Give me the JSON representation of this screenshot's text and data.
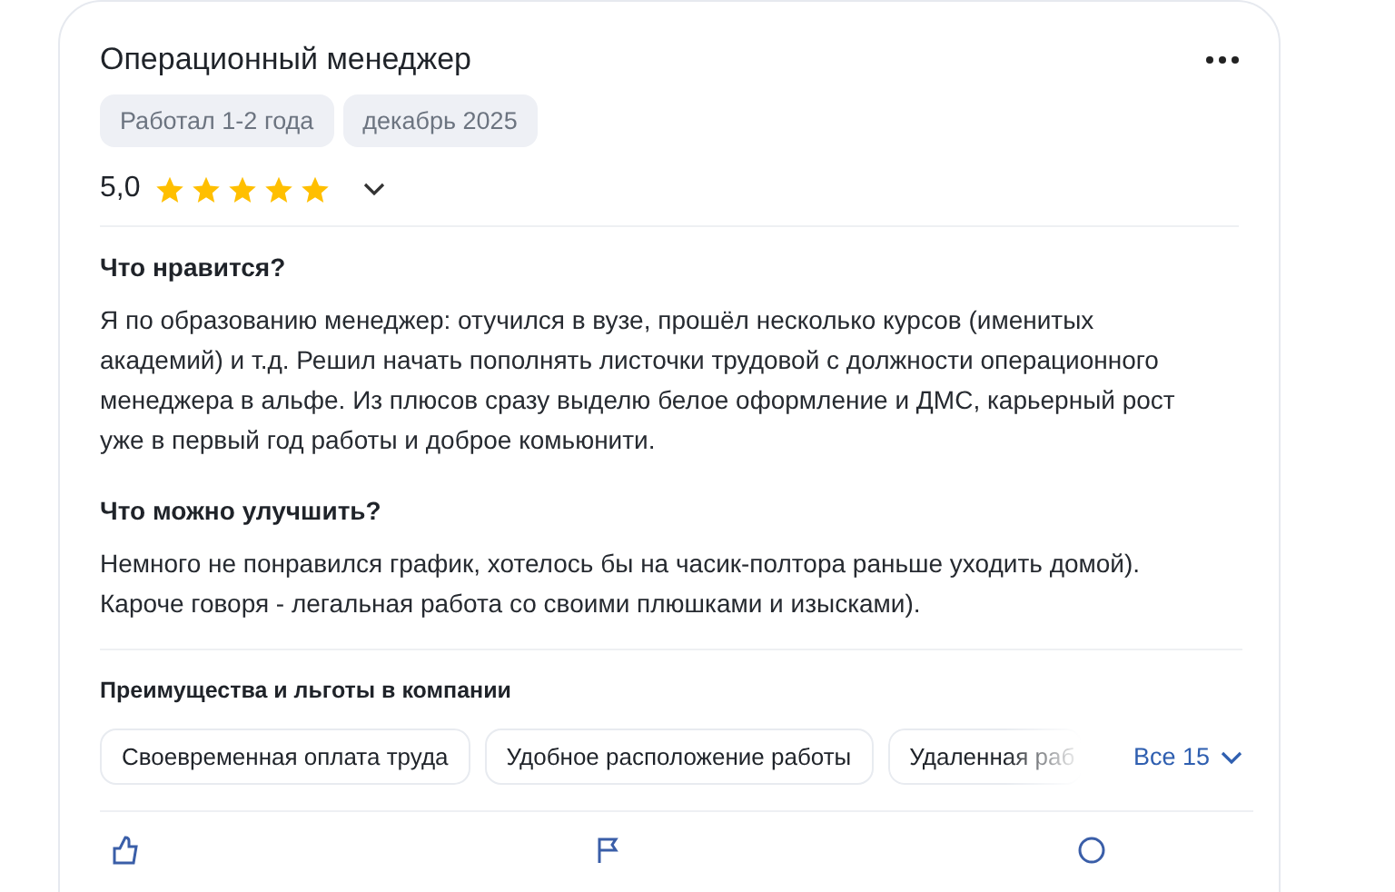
{
  "review": {
    "title": "Операционный менеджер",
    "tags": [
      "Работал 1-2 года",
      "декабрь 2025"
    ],
    "rating": "5,0",
    "stars": 5,
    "sections": [
      {
        "heading": "Что нравится?",
        "text": "Я по образованию менеджер: отучился в вузе, прошёл несколько курсов (именитых академий) и т.д. Решил начать пополнять листочки трудовой с должности операционного менеджера в альфе. Из плюсов сразу выделю белое оформление и ДМС, карьерный рост уже в первый год работы и доброе комьюнити."
      },
      {
        "heading": "Что можно улучшить?",
        "text": "Немного не понравился график, хотелось бы на часик-полтора раньше уходить домой). Кароче говоря - легальная работа со своими плюшками и изысками)."
      }
    ],
    "benefits": {
      "heading": "Преимущества и льготы в компании",
      "chips": [
        {
          "label": "Своевременная оплата труда",
          "faded": false
        },
        {
          "label": "Удобное расположение работы",
          "faded": false
        },
        {
          "label": "Удаленная раб",
          "faded": true
        }
      ],
      "more": "Все 15"
    }
  }
}
